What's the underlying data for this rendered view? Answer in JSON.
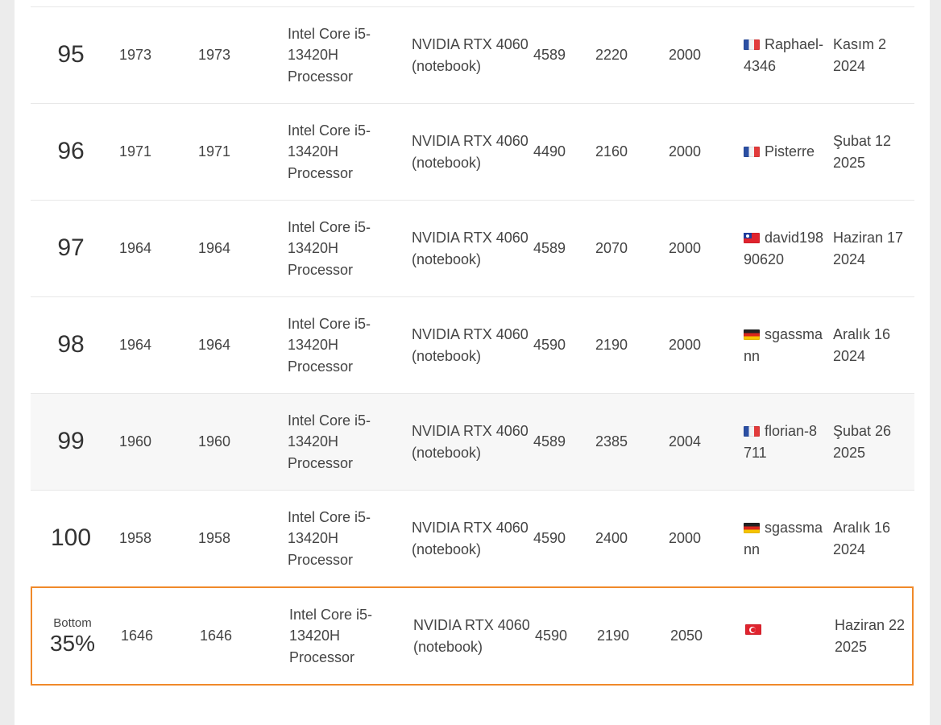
{
  "rows": [
    {
      "rank": "95",
      "score1": "1973",
      "score2": "1973",
      "cpu": "Intel Core i5-13420H Processor",
      "gpu": "NVIDIA RTX 4060 (notebook)",
      "n1": "4589",
      "n2": "2220",
      "n3": "2000",
      "flag": "fr",
      "user": "Raphael-4346",
      "date": "Kasım 2 2024"
    },
    {
      "rank": "96",
      "score1": "1971",
      "score2": "1971",
      "cpu": "Intel Core i5-13420H Processor",
      "gpu": "NVIDIA RTX 4060 (notebook)",
      "n1": "4490",
      "n2": "2160",
      "n3": "2000",
      "flag": "fr",
      "user": "Pisterre",
      "date": "Şubat 12 2025"
    },
    {
      "rank": "97",
      "score1": "1964",
      "score2": "1964",
      "cpu": "Intel Core i5-13420H Processor",
      "gpu": "NVIDIA RTX 4060 (notebook)",
      "n1": "4589",
      "n2": "2070",
      "n3": "2000",
      "flag": "tw",
      "user": "david19890620",
      "date": "Haziran 17 2024"
    },
    {
      "rank": "98",
      "score1": "1964",
      "score2": "1964",
      "cpu": "Intel Core i5-13420H Processor",
      "gpu": "NVIDIA RTX 4060 (notebook)",
      "n1": "4590",
      "n2": "2190",
      "n3": "2000",
      "flag": "de",
      "user": "sgassmann",
      "date": "Aralık 16 2024"
    },
    {
      "rank": "99",
      "score1": "1960",
      "score2": "1960",
      "cpu": "Intel Core i5-13420H Processor",
      "gpu": "NVIDIA RTX 4060 (notebook)",
      "n1": "4589",
      "n2": "2385",
      "n3": "2004",
      "flag": "fr",
      "user": "florian-8711",
      "date": "Şubat 26 2025"
    },
    {
      "rank": "100",
      "score1": "1958",
      "score2": "1958",
      "cpu": "Intel Core i5-13420H Processor",
      "gpu": "NVIDIA RTX 4060 (notebook)",
      "n1": "4590",
      "n2": "2400",
      "n3": "2000",
      "flag": "de",
      "user": "sgassmann",
      "date": "Aralık 16 2024"
    }
  ],
  "highlight": {
    "rank_label": "Bottom",
    "rank_pct": "35%",
    "score1": "1646",
    "score2": "1646",
    "cpu": "Intel Core i5-13420H Processor",
    "gpu": "NVIDIA RTX 4060 (notebook)",
    "n1": "4590",
    "n2": "2190",
    "n3": "2050",
    "flag": "tr",
    "user": "",
    "date": "Haziran 22 2025"
  },
  "colors": {
    "highlight_border": "#f0892a",
    "alt_row": "#f7f7f7"
  }
}
